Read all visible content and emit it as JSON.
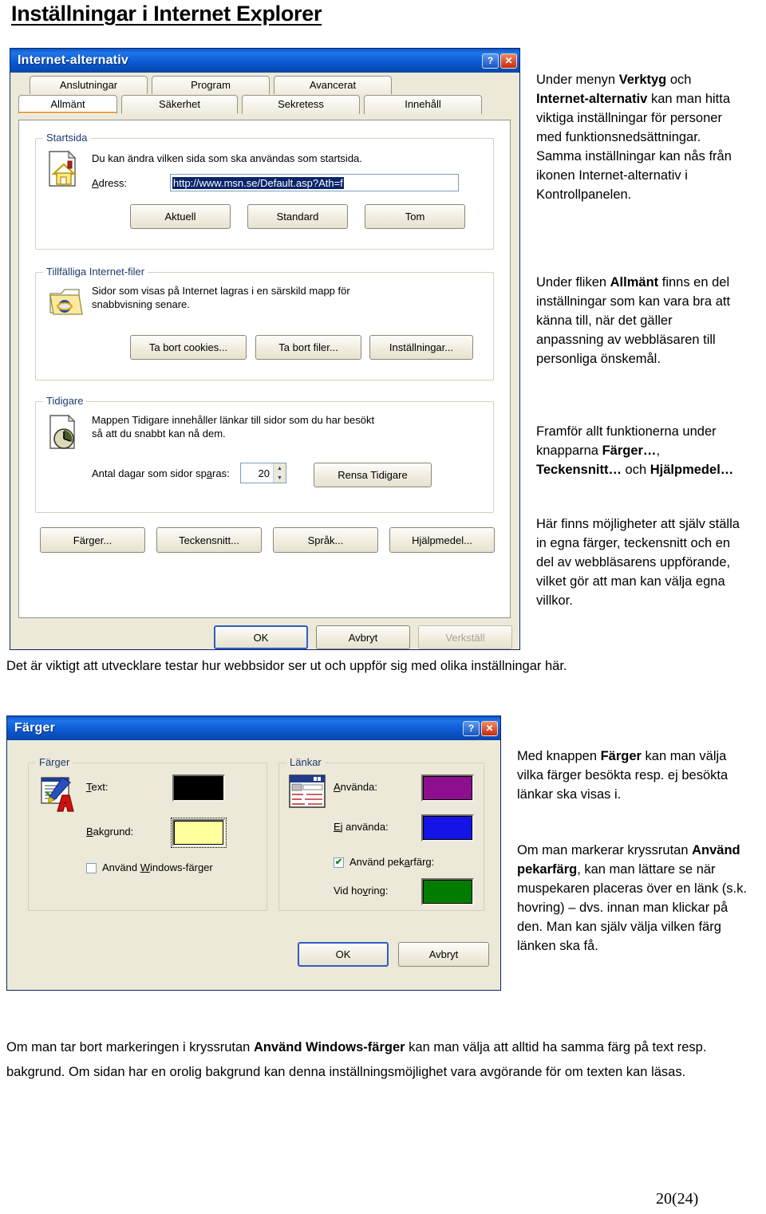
{
  "page": {
    "title": "Inställningar i Internet Explorer",
    "number": "20(24)"
  },
  "dialog_internet_options": {
    "title": "Internet-alternativ",
    "titlebar_buttons": {
      "help": "?",
      "close": "✕"
    },
    "tabs_row1": [
      "Anslutningar",
      "Program",
      "Avancerat"
    ],
    "tabs_row2": [
      "Allmänt",
      "Säkerhet",
      "Sekretess",
      "Innehåll"
    ],
    "active_tab": "Allmänt",
    "group_startsida": {
      "legend": "Startsida",
      "description": "Du kan ändra vilken sida som ska användas som startsida.",
      "address_label": "Adress:",
      "address_value": "http://www.msn.se/Default.asp?Ath=f",
      "buttons": [
        "Aktuell",
        "Standard",
        "Tom"
      ]
    },
    "group_temp_files": {
      "legend": "Tillfälliga Internet-filer",
      "description_line1": "Sidor som visas på Internet lagras i en särskild mapp för",
      "description_line2": "snabbvisning senare.",
      "buttons": [
        "Ta bort cookies...",
        "Ta bort filer...",
        "Inställningar..."
      ]
    },
    "group_history": {
      "legend": "Tidigare",
      "description_line1": "Mappen Tidigare innehåller länkar till sidor som du har besökt",
      "description_line2": "så att du snabbt kan nå dem.",
      "days_label": "Antal dagar som sidor sparas:",
      "days_value": "20",
      "clear_button": "Rensa Tidigare"
    },
    "bottom_buttons": [
      "Färger...",
      "Teckensnitt...",
      "Språk...",
      "Hjälpmedel..."
    ],
    "action_buttons": {
      "ok": "OK",
      "cancel": "Avbryt",
      "apply": "Verkställ"
    }
  },
  "dialog_colors": {
    "title": "Färger",
    "titlebar_buttons": {
      "help": "?",
      "close": "✕"
    },
    "group_colors": {
      "legend": "Färger",
      "text_label": "Text:",
      "text_color": "#000000",
      "background_label": "Bakgrund:",
      "background_color": "#FFFF9E",
      "checkbox_label": "Använd Windows-färger",
      "checkbox_checked": false
    },
    "group_links": {
      "legend": "Länkar",
      "visited_label": "Använda:",
      "visited_color": "#8E0F8E",
      "unvisited_label": "Ej använda:",
      "unvisited_color": "#1414E6",
      "hover_checkbox_label": "Använd pekarfärg:",
      "hover_checkbox_checked": true,
      "hover_label": "Vid hovring:",
      "hover_color": "#007D00"
    },
    "action_buttons": {
      "ok": "OK",
      "cancel": "Avbryt"
    }
  },
  "prose": {
    "p1_a": "Under menyn ",
    "p1_b1": "Verktyg",
    "p1_c": " och ",
    "p1_b2": "Internet-alternativ",
    "p1_d": " kan man hitta viktiga inställningar för personer med funktionsnedsättningar. Samma inställningar kan nås från ikonen Internet-alternativ i Kontrollpanelen.",
    "p2_a": "Under fliken ",
    "p2_b": "Allmänt",
    "p2_c": " finns en del inställningar som kan vara bra att känna till, när det gäller anpassning av webbläsaren till personliga önskemål.",
    "p3_a": "Framför allt funktionerna under knapparna ",
    "p3_b1": "Färger…",
    "p3_c": ", ",
    "p3_b2": "Teckensnitt…",
    "p3_d": " och ",
    "p3_b3": "Hjälpmedel…",
    "p4": "Här finns möjligheter att själv ställa in egna färger, teckensnitt och en del av webbläsarens uppförande, vilket gör att man kan välja egna villkor.",
    "fullwidth_1": "Det är viktigt att utvecklare testar hur webbsidor ser ut och uppför sig med olika inställningar här.",
    "p5_a": "Med knappen ",
    "p5_b": "Färger",
    "p5_c": " kan man välja vilka färger besökta resp. ej besökta länkar ska visas i.",
    "p6_a": "Om man markerar kryssrutan ",
    "p6_b": "Använd pekarfärg",
    "p6_c": ", kan man lättare se när muspekaren placeras över en länk (s.k. hovring) – dvs. innan man klickar på den. Man kan själv välja vilken färg länken ska få.",
    "p7_a": "Om man tar bort markeringen i kryssrutan ",
    "p7_b": "Använd Windows-färger",
    "p7_c": " kan man välja att alltid ha samma färg på text resp. bakgrund. Om sidan har en orolig bakgrund kan denna inställningsmöjlighet vara avgörande för om texten kan läsas."
  },
  "icons": {
    "home": "home-page-icon",
    "folder": "temp-files-folder-icon",
    "history": "history-clock-icon",
    "colors": "colors-pen-icon",
    "links": "links-page-icon"
  }
}
